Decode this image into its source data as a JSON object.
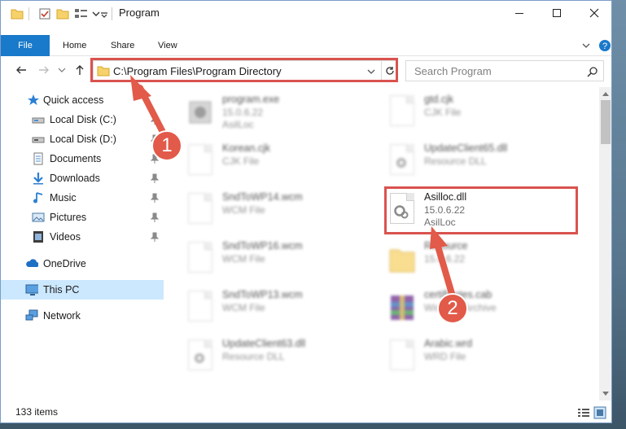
{
  "window": {
    "title": "Program",
    "status_count": "133 items"
  },
  "ribbon": {
    "tabs": [
      {
        "label": "File"
      },
      {
        "label": "Home"
      },
      {
        "label": "Share"
      },
      {
        "label": "View"
      }
    ]
  },
  "address": {
    "path": "C:\\Program Files\\Program Directory"
  },
  "search": {
    "placeholder": "Search Program"
  },
  "sidebar": {
    "items": [
      {
        "label": "Quick access",
        "icon": "star-icon"
      },
      {
        "label": "Local Disk (C:)",
        "icon": "drive-icon"
      },
      {
        "label": "Local Disk (D:)",
        "icon": "drive-icon"
      },
      {
        "label": "Documents",
        "icon": "documents-icon"
      },
      {
        "label": "Downloads",
        "icon": "download-icon"
      },
      {
        "label": "Music",
        "icon": "music-icon"
      },
      {
        "label": "Pictures",
        "icon": "pictures-icon"
      },
      {
        "label": "Videos",
        "icon": "videos-icon"
      },
      {
        "label": "OneDrive",
        "icon": "cloud-icon"
      },
      {
        "label": "This PC",
        "icon": "computer-icon"
      },
      {
        "label": "Network",
        "icon": "network-icon"
      }
    ]
  },
  "files": {
    "left": [
      {
        "name": "program.exe",
        "meta1": "15.0.6.22",
        "meta2": "AsilLoc"
      },
      {
        "name": "Korean.cjk",
        "meta1": "CJK File",
        "meta2": ""
      },
      {
        "name": "SndToWP14.wcm",
        "meta1": "WCM File",
        "meta2": ""
      },
      {
        "name": "SndToWP16.wcm",
        "meta1": "WCM File",
        "meta2": ""
      },
      {
        "name": "SndToWP13.wcm",
        "meta1": "WCM File",
        "meta2": ""
      },
      {
        "name": "UpdateClient63.dll",
        "meta1": "Resource DLL",
        "meta2": ""
      }
    ],
    "right": [
      {
        "name": "gtd.cjk",
        "meta1": "CJK File",
        "meta2": ""
      },
      {
        "name": "UpdateClient65.dll",
        "meta1": "Resource DLL",
        "meta2": ""
      },
      {
        "name": "Asilloc.dll",
        "meta1": "15.0.6.22",
        "meta2": "AsilLoc"
      },
      {
        "name": "Resource",
        "meta1": "15.0.6.22",
        "meta2": ""
      },
      {
        "name": "certificates.cab",
        "meta1": "WinRAR Archive",
        "meta2": ""
      },
      {
        "name": "Arabic.wrd",
        "meta1": "WRD File",
        "meta2": ""
      }
    ]
  },
  "annotations": {
    "step1": "1",
    "step2": "2",
    "color": "#e25a49"
  },
  "colors": {
    "accent": "#1979ca",
    "selection": "#cce8ff"
  }
}
